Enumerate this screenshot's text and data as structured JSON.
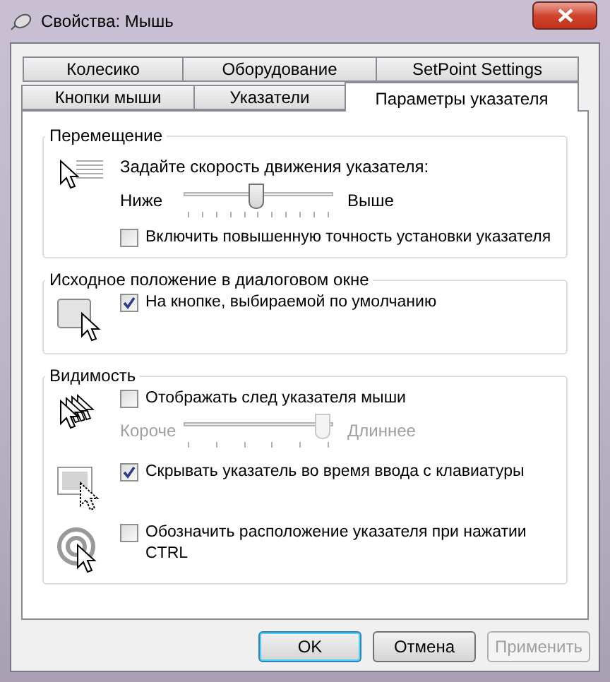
{
  "window": {
    "title": "Свойства: Мышь"
  },
  "tab_rows": [
    [
      {
        "label": "Колесико",
        "selected": false
      },
      {
        "label": "Оборудование",
        "selected": false
      },
      {
        "label": "SetPoint Settings",
        "selected": false
      }
    ],
    [
      {
        "label": "Кнопки мыши",
        "selected": false
      },
      {
        "label": "Указатели",
        "selected": false
      },
      {
        "label": "Параметры указателя",
        "selected": true
      }
    ]
  ],
  "groups": [
    {
      "title": "Перемещение",
      "blocks": [
        {
          "controls": [
            {
              "kind": "label",
              "text": "Задайте скорость движения указателя:"
            },
            {
              "kind": "slider",
              "low_label": "Ниже",
              "high_label": "Выше",
              "level": 0.5,
              "disabled": false
            },
            {
              "kind": "checkbox",
              "label": "Включить повышенную точность установки указателя",
              "checked": false
            }
          ]
        }
      ]
    },
    {
      "title": "Исходное положение в диалоговом окне",
      "blocks": [
        {
          "controls": [
            {
              "kind": "checkbox",
              "label": "На кнопке, выбираемой по умолчанию",
              "checked": true
            }
          ]
        }
      ]
    },
    {
      "title": "Видимость",
      "blocks": [
        {
          "controls": [
            {
              "kind": "checkbox",
              "label": "Отображать след указателя мыши",
              "checked": false
            },
            {
              "kind": "slider",
              "low_label": "Короче",
              "high_label": "Длиннее",
              "level": 1,
              "disabled": true
            }
          ]
        },
        {
          "controls": [
            {
              "kind": "checkbox",
              "label": "Скрывать указатель во время ввода с клавиатуры",
              "checked": true
            }
          ]
        },
        {
          "controls": [
            {
              "kind": "checkbox",
              "label": "Обозначить расположение указателя при нажатии CTRL",
              "checked": false
            }
          ]
        }
      ]
    }
  ],
  "buttons": [
    {
      "label": "OK",
      "default": true,
      "disabled": false
    },
    {
      "label": "Отмена",
      "default": false,
      "disabled": false
    },
    {
      "label": "Применить",
      "default": false,
      "disabled": true
    }
  ]
}
